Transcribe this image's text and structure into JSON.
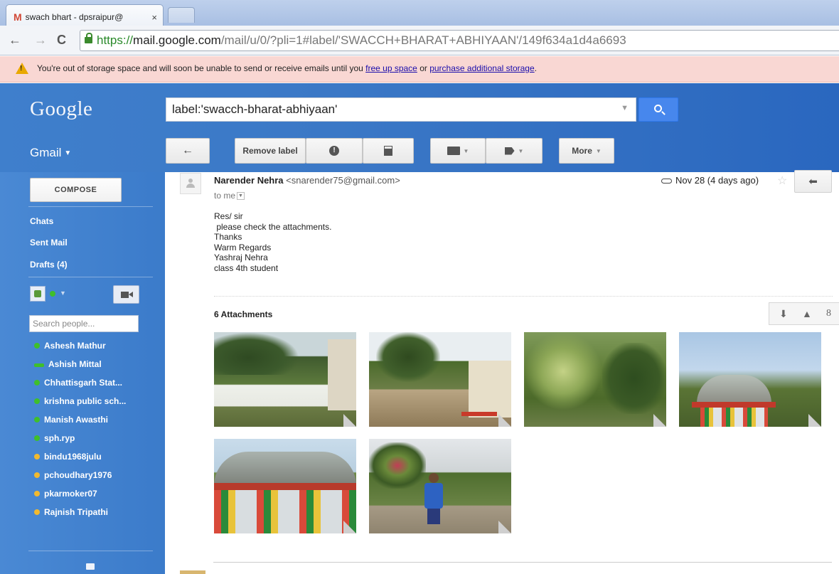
{
  "browser": {
    "tab_title": "swach bhart - dpsraipur@",
    "tab_close": "×",
    "url_scheme": "https://",
    "url_domain": "mail.google.com",
    "url_path": "/mail/u/0/?pli=1#label/'SWACCH+BHARAT+ABHIYAAN'/149f634a1d4a6693"
  },
  "banner": {
    "text_before": "You're out of storage space and will soon be unable to send or receive emails until you ",
    "link1": "free up space",
    "middle": " or ",
    "link2": "purchase additional storage",
    "end": ".",
    "color": "#f9d7d3"
  },
  "header": {
    "logo": "Google",
    "search_value": "label:'swacch-bharat-abhiyaan'",
    "gmail_menu": "Gmail",
    "accent": "#4787ed"
  },
  "toolbar": {
    "back_icon": "←",
    "remove_label": "Remove label",
    "spam_icon": "!",
    "more_label": "More"
  },
  "sidebar": {
    "compose": "COMPOSE",
    "nav": [
      "Chats",
      "Sent Mail",
      "Drafts (4)"
    ],
    "search_people_placeholder": "Search people...",
    "contacts": [
      {
        "name": "Ashesh Mathur",
        "status": "online"
      },
      {
        "name": "Ashish Mittal",
        "status": "mobile"
      },
      {
        "name": "Chhattisgarh Stat...",
        "status": "online"
      },
      {
        "name": "krishna public sch...",
        "status": "online"
      },
      {
        "name": "Manish Awasthi",
        "status": "online"
      },
      {
        "name": "sph.ryp",
        "status": "online"
      },
      {
        "name": "bindu1968julu",
        "status": "idle"
      },
      {
        "name": "pchoudhary1976",
        "status": "idle"
      },
      {
        "name": "pkarmoker07",
        "status": "idle"
      },
      {
        "name": "Rajnish Tripathi",
        "status": "idle"
      }
    ]
  },
  "message": {
    "sender_name": "Narender Nehra",
    "sender_email": "<snarender75@gmail.com>",
    "to": "to me",
    "date": "Nov 28 (4 days ago)",
    "body_lines": [
      "Res/ sir",
      " please check the attachments.",
      "Thanks",
      "Warm Regards",
      "Yashraj Nehra",
      "class 4th student"
    ],
    "attachments_title": "6 Attachments",
    "attachment_count": 6
  }
}
